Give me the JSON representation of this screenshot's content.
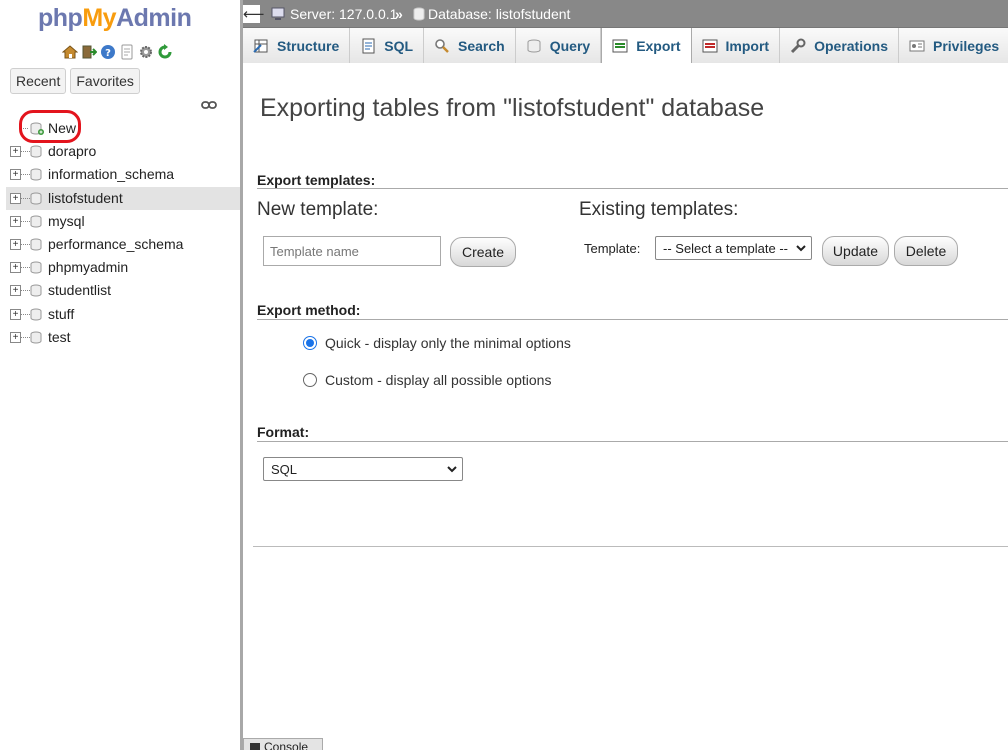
{
  "sidebar": {
    "logo": {
      "php": "php",
      "my": "My",
      "admin": "Admin"
    },
    "quick_icons": [
      "home-icon",
      "logout-icon",
      "help-icon",
      "docs-icon",
      "settings-icon",
      "reload-icon"
    ],
    "tabs": {
      "recent": "Recent",
      "favorites": "Favorites"
    },
    "tree": {
      "new": "New",
      "databases": [
        "dorapro",
        "information_schema",
        "listofstudent",
        "mysql",
        "performance_schema",
        "phpmyadmin",
        "studentlist",
        "stuff",
        "test"
      ],
      "selected": "listofstudent"
    }
  },
  "breadcrumb": {
    "server": "Server: 127.0.0.1",
    "separator": "»",
    "database": "Database: listofstudent"
  },
  "menu": {
    "tabs": [
      {
        "label": "Structure",
        "icon": "structure-icon"
      },
      {
        "label": "SQL",
        "icon": "sql-icon"
      },
      {
        "label": "Search",
        "icon": "search-icon"
      },
      {
        "label": "Query",
        "icon": "query-icon"
      },
      {
        "label": "Export",
        "icon": "export-icon",
        "active": true
      },
      {
        "label": "Import",
        "icon": "import-icon"
      },
      {
        "label": "Operations",
        "icon": "wrench-icon"
      },
      {
        "label": "Privileges",
        "icon": "privileges-icon"
      }
    ]
  },
  "main": {
    "title": "Exporting tables from \"listofstudent\" database",
    "export_templates": {
      "heading": "Export templates:",
      "new_heading": "New template:",
      "name_placeholder": "Template name",
      "create_label": "Create",
      "existing_heading": "Existing templates:",
      "template_label": "Template:",
      "select_value": "-- Select a template --",
      "update_label": "Update",
      "delete_label": "Delete"
    },
    "export_method": {
      "heading": "Export method:",
      "quick": "Quick - display only the minimal options",
      "custom": "Custom - display all possible options",
      "selected": "quick"
    },
    "format": {
      "heading": "Format:",
      "value": "SQL"
    }
  },
  "console": {
    "label": "Console"
  },
  "colors": {
    "accent": "#235a81",
    "highlight_circle": "#e3141d",
    "topbar": "#888888"
  }
}
